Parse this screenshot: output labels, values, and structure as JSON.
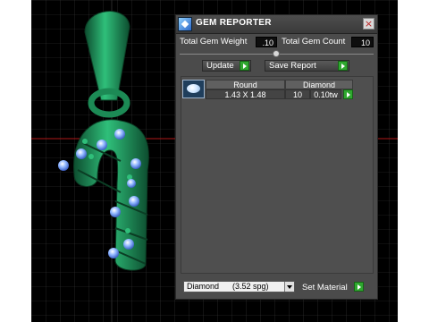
{
  "window": {
    "title": "GEM REPORTER",
    "close_symbol": "×"
  },
  "stats": {
    "total_gem_weight_label": "Total Gem Weight",
    "total_gem_weight_value": ".10",
    "total_gem_count_label": "Total Gem Count",
    "total_gem_count_value": "10"
  },
  "buttons": {
    "update": "Update",
    "save_report": "Save Report",
    "set_material": "Set Material"
  },
  "gem_list": {
    "columns": [
      "Round",
      "Diamond"
    ],
    "rows": [
      {
        "size": "1.43 X 1.48",
        "count": "10",
        "weight": "0.10tw"
      }
    ]
  },
  "material_select": {
    "selected": "Diamond      (3.52 spg)"
  },
  "colors": {
    "panel": "#4b4b4b",
    "accent_green": "#2fa82f",
    "viewport": "#000000",
    "model": "#1f8f5a"
  },
  "icons": [
    "app-icon",
    "close-icon",
    "play-icon",
    "chevron-down-icon",
    "gem-thumbnail"
  ]
}
